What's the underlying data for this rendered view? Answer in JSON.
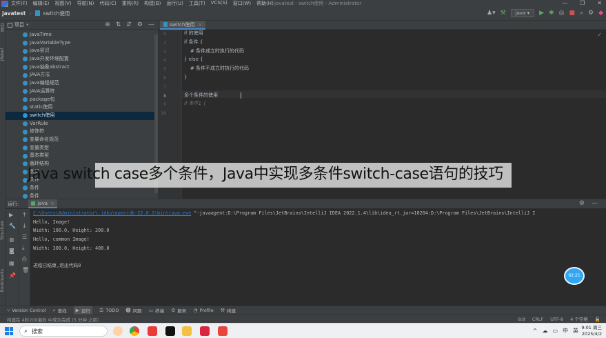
{
  "menubar": {
    "app_icon": "intellij-logo-icon",
    "items": [
      "文件(F)",
      "编辑(E)",
      "视图(V)",
      "导航(N)",
      "代码(C)",
      "重构(R)",
      "构建(B)",
      "运行(U)",
      "工具(T)",
      "VCS(S)",
      "窗口(W)",
      "帮助(H)"
    ],
    "window_title": "javatest - switch使用 - Administrator",
    "controls": [
      "—",
      "❐",
      "✕"
    ]
  },
  "navbar": {
    "project": "javatest",
    "file": "switch使用"
  },
  "toolbar": {
    "run_config": "java",
    "icons": [
      "hammer-icon",
      "run-icon",
      "debug-icon",
      "coverage-icon",
      "stop-icon",
      "search-icon",
      "settings-icon",
      "jetbrains-icon"
    ]
  },
  "left_stripe": {
    "labels": [
      "项目",
      "JRebel",
      "Structure",
      "Bookmarks"
    ]
  },
  "project_panel": {
    "title": "项目",
    "tree": [
      "JavaTime",
      "JavaVariableType",
      "java初识",
      "Java开发环境配置",
      "Java抽象abstract",
      "JAVA方法",
      "java编程规范",
      "JAVA运算符",
      "package包",
      "static使用",
      "switch使用",
      "VarRule",
      "修饰符",
      "变量命名规范",
      "变量类型",
      "基本类型",
      "循环结构",
      "数组",
      "文件",
      "条件",
      "条件"
    ],
    "selected_index": 10
  },
  "editor": {
    "tab": "switch使用",
    "line_numbers": [
      "5",
      "2",
      "3",
      "4",
      "5",
      "6",
      "7",
      "8",
      "9",
      "10"
    ],
    "current_line_index": 7,
    "code_lines": [
      {
        "text": "if 的使用",
        "kind": "normal"
      },
      {
        "text": "if 条件 {",
        "kind": "normal"
      },
      {
        "text": "    # 条件成立时执行的代码",
        "kind": "comment"
      },
      {
        "text": "} else {",
        "kind": "normal"
      },
      {
        "text": "    # 条件不成立时执行的代码",
        "kind": "comment"
      },
      {
        "text": "}",
        "kind": "normal"
      },
      {
        "text": "",
        "kind": "normal"
      },
      {
        "text": "多个条件的使用",
        "kind": "normal"
      },
      {
        "text": "if 条件1 {",
        "kind": "ghost"
      }
    ]
  },
  "overlay": {
    "caption": "Java switch case多个条件，Java中实现多条件switch-case语句的技巧"
  },
  "run_panel": {
    "label": "运行:",
    "tab": "java",
    "command_link": "C:\\Users\\Administrator\\.jdks\\openjdk-22.0.1\\bin\\java.exe",
    "command_rest": " \"-javaagent:D:\\Program Files\\JetBrains\\IntelliJ IDEA 2022.1.4\\lib\\idea_rt.jar=10204:D:\\Program Files\\JetBrains\\IntelliJ I",
    "output": [
      "Hello, Image!",
      "Width: 100.0, Height: 200.0",
      "Hello, common Image!",
      "Width: 300.0, Height: 400.0",
      "",
      "进程已结束,退出代码0"
    ],
    "bubble": "62:21"
  },
  "bottom_tools": [
    {
      "label": "Version Control",
      "icon": "vcs-icon"
    },
    {
      "label": "查找",
      "icon": "search-icon"
    },
    {
      "label": "运行",
      "icon": "run-icon"
    },
    {
      "label": "TODO",
      "icon": "todo-icon"
    },
    {
      "label": "问题",
      "icon": "problems-icon"
    },
    {
      "label": "终端",
      "icon": "terminal-icon"
    },
    {
      "label": "服务",
      "icon": "services-icon"
    },
    {
      "label": "Profile",
      "icon": "profiler-icon"
    },
    {
      "label": "构建",
      "icon": "build-icon"
    }
  ],
  "statusbar": {
    "message": "构建在 4秒200毫秒 中成功完成 (5 分钟 之前)",
    "position": "8:8",
    "line_sep": "CRLF",
    "encoding": "UTF-8",
    "indent": "4 个空格"
  },
  "taskbar": {
    "search_placeholder": "搜索",
    "time": "9:01 周三",
    "date": "2025/4/2",
    "tray": [
      "^",
      "☁",
      "▭",
      "中",
      "英"
    ]
  }
}
